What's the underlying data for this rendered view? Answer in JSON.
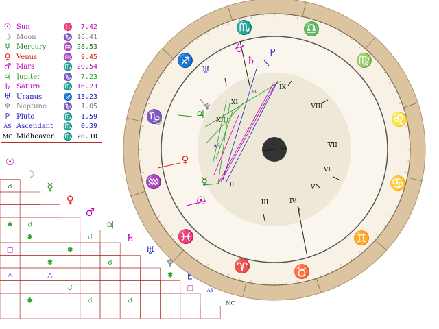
{
  "colors": {
    "zodiac_ring": "#dcc4a0",
    "house_ring": "#f7f1e6",
    "inner_disc": "#eee8d8",
    "border": "#a88",
    "legend_border": "#b03030",
    "grid": "#b03030",
    "moon_dot": "#333333"
  },
  "legend": [
    {
      "glyph": "☉",
      "name": "Sun",
      "sign": "♓",
      "degree": "7.42",
      "color": "#c000c0"
    },
    {
      "glyph": "☽",
      "name": "Moon",
      "sign": "♑",
      "degree": "16.41",
      "color": "#808080"
    },
    {
      "glyph": "☿",
      "name": "Mercury",
      "sign": "♒",
      "degree": "28.53",
      "color": "#208020"
    },
    {
      "glyph": "♀",
      "name": "Venus",
      "sign": "♒",
      "degree": "9.45",
      "color": "#e02020"
    },
    {
      "glyph": "♂",
      "name": "Mars",
      "sign": "♏",
      "degree": "20.54",
      "color": "#c000c0"
    },
    {
      "glyph": "♃",
      "name": "Jupiter",
      "sign": "♑",
      "degree": "7.23",
      "color": "#20a020"
    },
    {
      "glyph": "♄",
      "name": "Saturn",
      "sign": "♏",
      "degree": "16.23",
      "color": "#c000c0"
    },
    {
      "glyph": "♅",
      "name": "Uranus",
      "sign": "♐",
      "degree": "13.23",
      "color": "#2020c0"
    },
    {
      "glyph": "♆",
      "name": "Neptune",
      "sign": "♑",
      "degree": "1.05",
      "color": "#808080"
    },
    {
      "glyph": "♇",
      "name": "Pluto",
      "sign": "♏",
      "degree": "1.59",
      "color": "#2020c0"
    },
    {
      "glyph": "AS",
      "name": "Ascendant",
      "sign": "♏",
      "degree": "0.39",
      "color": "#2020c0"
    },
    {
      "glyph": "MC",
      "name": "Midheaven",
      "sign": "♏",
      "degree": "20.10",
      "color": "#000000"
    }
  ],
  "aspect_grid": {
    "headers": [
      {
        "glyph": "☉",
        "color": "#c000c0"
      },
      {
        "glyph": "☽",
        "color": "#808080"
      },
      {
        "glyph": "☿",
        "color": "#208020"
      },
      {
        "glyph": "♀",
        "color": "#e02020"
      },
      {
        "glyph": "♂",
        "color": "#c000c0"
      },
      {
        "glyph": "♃",
        "color": "#20a020"
      },
      {
        "glyph": "♄",
        "color": "#c000c0"
      },
      {
        "glyph": "♅",
        "color": "#2020c0"
      },
      {
        "glyph": "♆",
        "color": "#808080"
      },
      {
        "glyph": "♇",
        "color": "#2020c0"
      },
      {
        "glyph": "AS",
        "color": "#2020c0"
      },
      {
        "glyph": "MC",
        "color": "#000000"
      }
    ],
    "cells": [
      {
        "row": 1,
        "col": 0,
        "sym": "☌",
        "color": "#20a020"
      },
      {
        "row": 4,
        "col": 0,
        "sym": "✱",
        "color": "#20a020"
      },
      {
        "row": 4,
        "col": 1,
        "sym": "☌",
        "color": "#20a020"
      },
      {
        "row": 5,
        "col": 1,
        "sym": "✱",
        "color": "#20a020"
      },
      {
        "row": 5,
        "col": 4,
        "sym": "☌",
        "color": "#20a020"
      },
      {
        "row": 6,
        "col": 0,
        "sym": "□",
        "color": "#c000c0"
      },
      {
        "row": 6,
        "col": 3,
        "sym": "✱",
        "color": "#20a020"
      },
      {
        "row": 7,
        "col": 2,
        "sym": "✱",
        "color": "#20a020"
      },
      {
        "row": 7,
        "col": 5,
        "sym": "☌",
        "color": "#20a020"
      },
      {
        "row": 8,
        "col": 0,
        "sym": "△",
        "color": "#2020c0"
      },
      {
        "row": 8,
        "col": 2,
        "sym": "△",
        "color": "#2020c0"
      },
      {
        "row": 8,
        "col": 8,
        "sym": "✱",
        "color": "#20a020"
      },
      {
        "row": 9,
        "col": 3,
        "sym": "☌",
        "color": "#20a020"
      },
      {
        "row": 9,
        "col": 9,
        "sym": "□",
        "color": "#c000c0"
      },
      {
        "row": 10,
        "col": 1,
        "sym": "✱",
        "color": "#20a020"
      },
      {
        "row": 10,
        "col": 4,
        "sym": "☌",
        "color": "#20a020"
      },
      {
        "row": 10,
        "col": 6,
        "sym": "☌",
        "color": "#20a020"
      }
    ]
  },
  "wheel": {
    "signs": [
      {
        "glyph": "♈",
        "color": "#e02020"
      },
      {
        "glyph": "♉",
        "color": "#20a020"
      },
      {
        "glyph": "♊",
        "color": "#2020c0"
      },
      {
        "glyph": "♋",
        "color": "#e02020"
      },
      {
        "glyph": "♌",
        "color": "#20a020"
      },
      {
        "glyph": "♍",
        "color": "#2020c0"
      },
      {
        "glyph": "♎",
        "color": "#e02020"
      },
      {
        "glyph": "♏",
        "color": "#20a020"
      },
      {
        "glyph": "♐",
        "color": "#2020c0"
      },
      {
        "glyph": "♑",
        "color": "#e02020"
      },
      {
        "glyph": "♒",
        "color": "#20a020"
      },
      {
        "glyph": "♓",
        "color": "#2020c0"
      }
    ],
    "houses": [
      "II",
      "III",
      "IV",
      "V",
      "VI",
      "VII",
      "VIII",
      "IX",
      "XI",
      "XII"
    ],
    "asc_label": "AS",
    "mc_label": "MC"
  }
}
